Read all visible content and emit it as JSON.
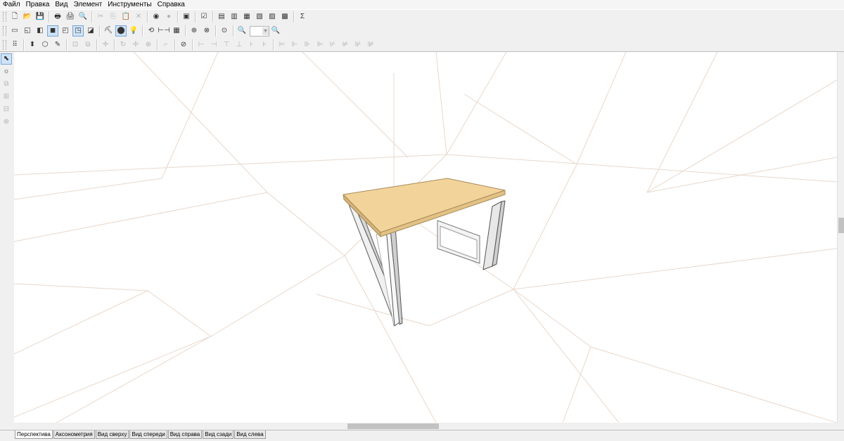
{
  "menu": [
    "Файл",
    "Правка",
    "Вид",
    "Элемент",
    "Инструменты",
    "Справка"
  ],
  "toolbar1_icons": [
    "new-file-icon",
    "open-icon",
    "save-icon",
    "sep",
    "print-preview-icon",
    "print-icon",
    "find-icon",
    "sep",
    "cut-icon",
    "copy-icon",
    "paste-icon",
    "delete-icon",
    "sep",
    "globe-icon",
    "material-icon",
    "sep",
    "block-icon",
    "sep",
    "properties-icon",
    "sep",
    "model-list-icon",
    "report-icon",
    "furniture-icon",
    "fittings-icon",
    "panel-icon",
    "cut-sheet-icon",
    "sep",
    "sum-icon"
  ],
  "toolbar1_glyphs": [
    "🗋",
    "📂",
    "💾",
    "",
    "🖶",
    "🖨",
    "🔍",
    "",
    "✂",
    "⎘",
    "📋",
    "✕",
    "",
    "◉",
    "●",
    "",
    "▣",
    "",
    "☑",
    "",
    "▤",
    "▥",
    "▦",
    "▧",
    "▨",
    "▩",
    "",
    "Σ"
  ],
  "toolbar2_glyphs": [
    "▭",
    "◱",
    "◧",
    "◼",
    "◰",
    "◳",
    "◪",
    "",
    "⛏",
    "⬤",
    "💡",
    "",
    "⟲",
    "⊢⊣",
    "▦",
    "",
    "⊕",
    "⊗",
    "",
    "⊙",
    "",
    "🔍"
  ],
  "toolbar2_icons": [
    "wire-view-icon",
    "outline-view-icon",
    "shaded-view-icon",
    "solid-view-icon",
    "view-front-icon",
    "view-side-icon",
    "view-box-icon",
    "sep",
    "texture-icon",
    "sphere-icon",
    "light-icon",
    "sep",
    "rotate-icon",
    "dimension-icon",
    "grid-icon",
    "sep",
    "magnet-icon",
    "snap-icon",
    "sep",
    "target-icon",
    "sep",
    "zoom-icon"
  ],
  "toolbar3_glyphs": [
    "⠿",
    "",
    "⬍",
    "⬡",
    "✎",
    "",
    "⊡",
    "⧉",
    "",
    "✛",
    "",
    "↻",
    "✢",
    "⊕",
    "",
    "⌐",
    "",
    "⊘",
    "",
    "⊢",
    "⊣",
    "⊤",
    "⊥",
    "⊦",
    "⊧",
    "",
    "⊨",
    "⊩",
    "⊪",
    "⊫",
    "⊬",
    "⊭",
    "⊮",
    "⊯"
  ],
  "toolbar3_icons": [
    "dots-grid-icon",
    "sep",
    "move-up-icon",
    "cube-icon",
    "pencil-icon",
    "sep",
    "select-box-icon",
    "copy-obj-icon",
    "sep",
    "move-icon",
    "sep",
    "rotate-obj-icon",
    "move-cross-icon",
    "pivot-icon",
    "sep",
    "corner-icon",
    "sep",
    "stop-icon",
    "sep",
    "align-left-icon",
    "align-right-icon",
    "align-top-icon",
    "align-bottom-icon",
    "align-center-icon",
    "align-middle-icon",
    "sep",
    "distribute-1-icon",
    "distribute-2-icon",
    "distribute-3-icon",
    "distribute-4-icon",
    "distribute-5-icon",
    "distribute-6-icon",
    "distribute-7-icon",
    "distribute-8-icon"
  ],
  "left_icons": [
    "cursor-icon",
    "light-sun-icon",
    "copy-panel-icon",
    "hole-icon",
    "edge-icon",
    "zoom-panel-icon"
  ],
  "left_glyphs": [
    "⬉",
    "☼",
    "⧉",
    "⊞",
    "⊟",
    "⊕"
  ],
  "zoom_value": "",
  "tabs": [
    "Перспектива",
    "Аксонометрия",
    "Вид сверху",
    "Вид спереди",
    "Вид справа",
    "Вид сзади",
    "Вид слева"
  ],
  "active_tab": 0,
  "colors": {
    "tabletop": "#f2d49b",
    "tabletop_edge": "#c9a56a",
    "frame": "#ffffff",
    "grid": "#e6d2c4"
  }
}
